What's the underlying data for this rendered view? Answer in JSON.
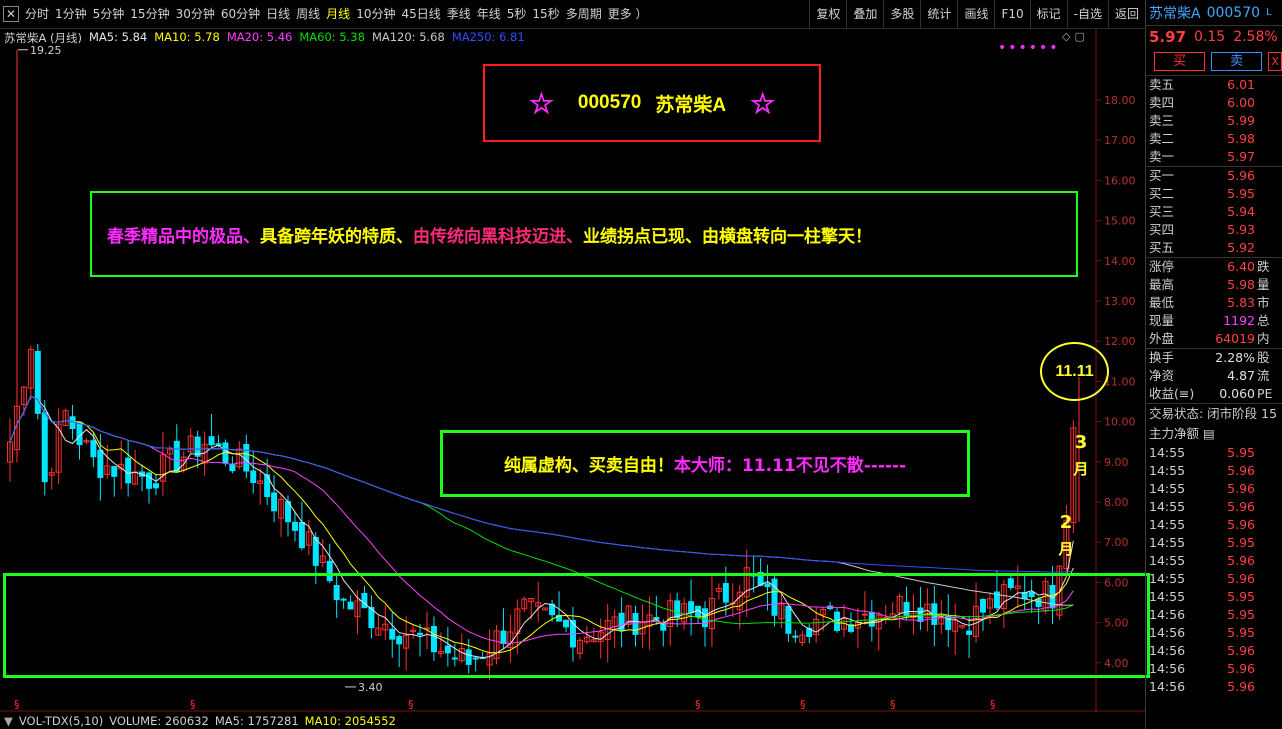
{
  "toolbar": {
    "periods": [
      "分时",
      "1分钟",
      "5分钟",
      "15分钟",
      "30分钟",
      "60分钟",
      "日线",
      "周线",
      "月线",
      "10分钟",
      "45日线",
      "季线",
      "年线",
      "5秒",
      "15秒",
      "多周期",
      "更多 ）"
    ],
    "active_index": 8,
    "right_items": [
      "复权",
      "叠加",
      "多股",
      "统计",
      "画线",
      "F10",
      "标记",
      "-自选",
      "返回"
    ]
  },
  "legend": {
    "name": "苏常柴A (月线)",
    "items": [
      {
        "label": "MA5: 5.84",
        "color": "#e6e6e6"
      },
      {
        "label": "MA10: 5.78",
        "color": "#ffff00"
      },
      {
        "label": "MA20: 5.46",
        "color": "#ff40ff"
      },
      {
        "label": "MA60: 5.38",
        "color": "#00e000"
      },
      {
        "label": "MA120: 5.68",
        "color": "#c8c8c8"
      },
      {
        "label": "MA250: 6.81",
        "color": "#3050ff"
      }
    ]
  },
  "price_axis": [
    "18.00",
    "17.00",
    "16.00",
    "15.00",
    "14.00",
    "13.00",
    "12.00",
    "11.00",
    "10.00",
    "9.00",
    "8.00",
    "7.00",
    "6.00",
    "5.00",
    "4.00"
  ],
  "annotations": {
    "high_label": "19.25",
    "low_label": "3.40",
    "title_code": "000570",
    "title_name": "苏常柴A",
    "star": "☆",
    "dots": "••••••",
    "slogan_parts": [
      {
        "text": "春季精品中的极品、",
        "color": "#ff2bff"
      },
      {
        "text": "具备跨年妖的特质、",
        "color": "#ffff00"
      },
      {
        "text": "由传统向黑科技迈进、",
        "color": "#ff2b7a"
      },
      {
        "text": "业绩拐点已现、",
        "color": "#ffff00"
      },
      {
        "text": "由横盘转向一柱擎天！",
        "color": "#ffff00"
      }
    ],
    "disclaimer_parts": [
      {
        "text": "纯属虚构、买卖自由！",
        "color": "#ffff00"
      },
      {
        "text": "本大师：11.11不见不散------",
        "color": "#ff2bff"
      }
    ],
    "target": "11.11",
    "month3": [
      "3",
      "月"
    ],
    "month2": [
      "2",
      "月"
    ],
    "s_marker": "§"
  },
  "volume_bar": {
    "items": [
      {
        "label": "VOL-TDX(5,10)",
        "color": "#d0d0d0"
      },
      {
        "label": "VOLUME: 260632",
        "color": "#d0d0d0"
      },
      {
        "label": "MA5: 1757281",
        "color": "#d0d0d0"
      },
      {
        "label": "MA10: 2054552",
        "color": "#ffff00"
      }
    ]
  },
  "quote": {
    "name": "苏常柴A",
    "code": "000570",
    "code_suffix": "L",
    "price": "5.97",
    "change": "0.15",
    "pct": "2.58%",
    "buy_label": "买",
    "sell_label": "卖",
    "x_label": "X",
    "asks": [
      {
        "label": "卖五",
        "price": "6.01"
      },
      {
        "label": "卖四",
        "price": "6.00"
      },
      {
        "label": "卖三",
        "price": "5.99"
      },
      {
        "label": "卖二",
        "price": "5.98"
      },
      {
        "label": "卖一",
        "price": "5.97"
      }
    ],
    "bids": [
      {
        "label": "买一",
        "price": "5.96"
      },
      {
        "label": "买二",
        "price": "5.95"
      },
      {
        "label": "买三",
        "price": "5.94"
      },
      {
        "label": "买四",
        "price": "5.93"
      },
      {
        "label": "买五",
        "price": "5.92"
      }
    ],
    "stats": [
      {
        "label": "涨停",
        "value": "6.40",
        "color": "red",
        "ext": "跌"
      },
      {
        "label": "最高",
        "value": "5.98",
        "color": "red",
        "ext": "量"
      },
      {
        "label": "最低",
        "value": "5.83",
        "color": "red",
        "ext": "市"
      },
      {
        "label": "现量",
        "value": "1192",
        "color": "mag",
        "ext": "总"
      },
      {
        "label": "外盘",
        "value": "64019",
        "color": "red",
        "ext": "内"
      }
    ],
    "stats2": [
      {
        "label": "换手",
        "value": "2.28%",
        "color": "wht",
        "ext": "股"
      },
      {
        "label": "净资",
        "value": "4.87",
        "color": "wht",
        "ext": "流"
      },
      {
        "label": "收益(≡)",
        "value": "0.060",
        "color": "wht",
        "ext": "PE"
      }
    ],
    "trade_status": "交易状态: 闭市阶段 15",
    "main_flow": "主力净额",
    "ticks": [
      {
        "time": "14:55",
        "price": "5.95",
        "color": "red"
      },
      {
        "time": "14:55",
        "price": "5.96",
        "color": "red"
      },
      {
        "time": "14:55",
        "price": "5.96",
        "color": "red"
      },
      {
        "time": "14:55",
        "price": "5.96",
        "color": "red"
      },
      {
        "time": "14:55",
        "price": "5.96",
        "color": "red"
      },
      {
        "time": "14:55",
        "price": "5.95",
        "color": "red"
      },
      {
        "time": "14:55",
        "price": "5.96",
        "color": "red"
      },
      {
        "time": "14:55",
        "price": "5.96",
        "color": "red"
      },
      {
        "time": "14:55",
        "price": "5.95",
        "color": "red"
      },
      {
        "time": "14:56",
        "price": "5.95",
        "color": "red"
      },
      {
        "time": "14:56",
        "price": "5.95",
        "color": "red"
      },
      {
        "time": "14:56",
        "price": "5.96",
        "color": "red"
      },
      {
        "time": "14:56",
        "price": "5.96",
        "color": "red"
      },
      {
        "time": "14:56",
        "price": "5.96",
        "color": "red"
      }
    ]
  }
}
